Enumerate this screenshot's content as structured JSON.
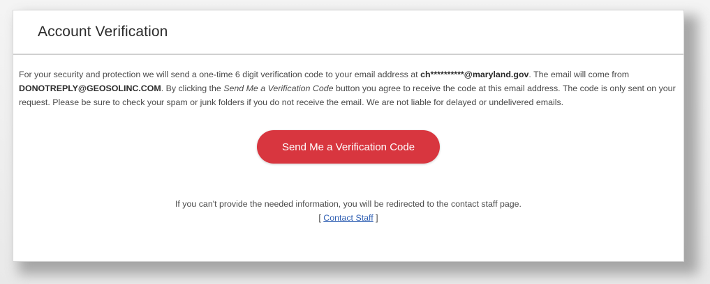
{
  "card": {
    "title": "Account Verification"
  },
  "message": {
    "part1": "For your security and protection we will send a one-time 6 digit verification code to your email address at ",
    "masked_email": "ch**********@maryland.gov",
    "part2": ". The email will come from ",
    "sender_email": "DONOTREPLY@GEOSOLINC.COM",
    "part3": ". By clicking the ",
    "button_reference": "Send Me a Verification Code",
    "part4": " button you agree to receive the code at this email address. The code is only sent on your request. Please be sure to check your spam or junk folders if you do not receive the email. We are not liable for delayed or undelivered emails."
  },
  "actions": {
    "send_code_label": "Send Me a Verification Code"
  },
  "footer": {
    "text": "If you can't provide the needed information, you will be redirected to the contact staff page.",
    "bracket_open": "[ ",
    "contact_link_label": "Contact Staff",
    "bracket_close": " ]"
  },
  "colors": {
    "button_bg": "#d8363f",
    "link": "#2f5fb3"
  }
}
